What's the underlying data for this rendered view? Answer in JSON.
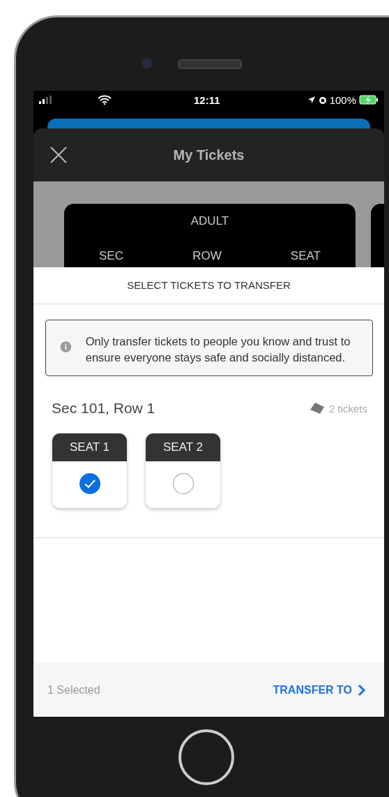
{
  "status_bar": {
    "time": "12:11",
    "battery": "100%"
  },
  "header": {
    "title": "My Tickets"
  },
  "ticket_preview": {
    "type": "ADULT",
    "labels": [
      "SEC",
      "ROW",
      "SEAT"
    ]
  },
  "panel": {
    "title": "SELECT TICKETS TO TRANSFER",
    "notice": "Only transfer tickets to people you know and trust to ensure everyone stays safe and socially distanced.",
    "section": "Sec 101, Row 1",
    "ticket_count": "2 tickets",
    "seats": [
      {
        "label": "SEAT 1",
        "selected": true
      },
      {
        "label": "SEAT 2",
        "selected": false
      }
    ]
  },
  "footer": {
    "selected_count": "1 Selected",
    "action": "TRANSFER TO"
  }
}
